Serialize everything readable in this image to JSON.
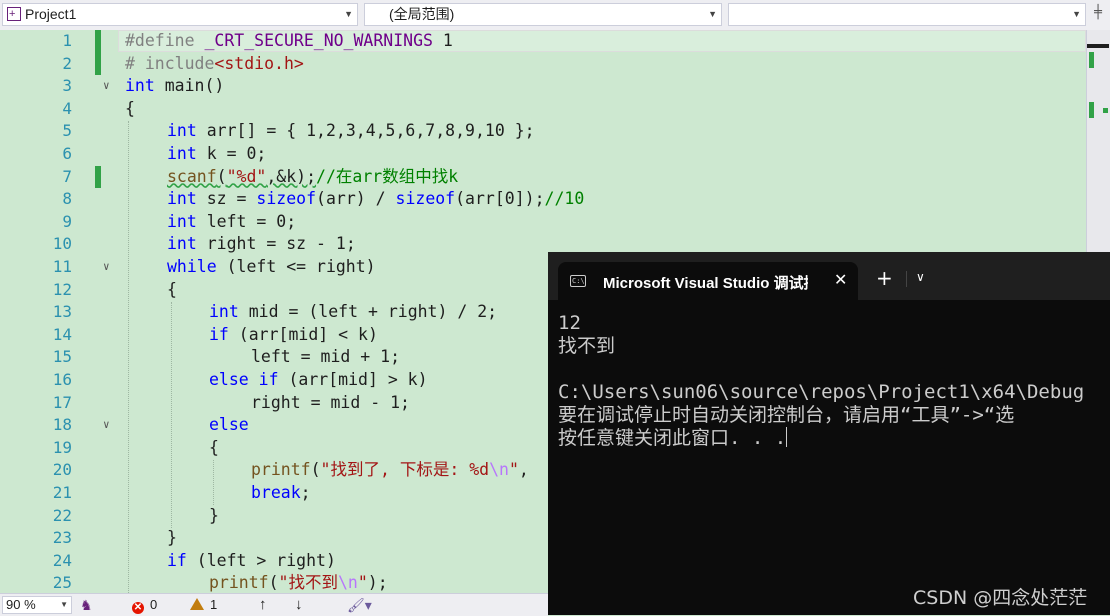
{
  "toolbar": {
    "project": "Project1",
    "scope": "(全局范围)",
    "member": ""
  },
  "editor": {
    "line_numbers": [
      "1",
      "2",
      "3",
      "4",
      "5",
      "6",
      "7",
      "8",
      "9",
      "10",
      "11",
      "12",
      "13",
      "14",
      "15",
      "16",
      "17",
      "18",
      "19",
      "20",
      "21",
      "22",
      "23",
      "24",
      "25"
    ],
    "code": {
      "l1_directive": "#define",
      "l1_macro": "_CRT_SECURE_NO_WARNINGS",
      "l1_value": " 1",
      "l2_directive": "# include",
      "l2_header": "<stdio.h>",
      "l3_kw": "int",
      "l3_rest": " main()",
      "l4": "{",
      "l5_kw": "int",
      "l5_rest": " arr[] = { 1,2,3,4,5,6,7,8,9,10 };",
      "l6_kw": "int",
      "l6_rest": " k = 0;",
      "l7_fn": "scanf",
      "l7_p1": "(",
      "l7_str": "\"%d\"",
      "l7_p2": ",&k);",
      "l7_comment": "//在arr数组中找k",
      "l8_kw": "int",
      "l8_p1": " sz = ",
      "l8_kw2": "sizeof",
      "l8_p2": "(arr) / ",
      "l8_kw3": "sizeof",
      "l8_p3": "(arr[0]);",
      "l8_comment": "//10",
      "l9_kw": "int",
      "l9_rest": " left = 0;",
      "l10_kw": "int",
      "l10_rest": " right = sz - 1;",
      "l11_kw": "while",
      "l11_rest": " (left <= right)",
      "l12": "{",
      "l13_kw": "int",
      "l13_rest": " mid = (left + right) / 2;",
      "l14_kw": "if",
      "l14_rest": " (arr[mid] < k)",
      "l15": "left = mid + 1;",
      "l16_kw": "else if",
      "l16_rest": " (arr[mid] > k)",
      "l17": "right = mid - 1;",
      "l18_kw": "else",
      "l19": "{",
      "l20_fn": "printf",
      "l20_p1": "(",
      "l20_str": "\"找到了, 下标是: %d",
      "l20_esc": "\\n",
      "l20_str2": "\"",
      "l20_p2": ",",
      "l21_kw": "break",
      "l21_p": ";",
      "l22": "}",
      "l23": "}",
      "l24_kw": "if",
      "l24_rest": " (left > right)",
      "l25_fn": "printf",
      "l25_p1": "(",
      "l25_str": "\"找不到",
      "l25_esc": "\\n",
      "l25_str2": "\"",
      "l25_p2": ");"
    }
  },
  "statusbar": {
    "zoom": "90 %",
    "errors": "0",
    "warnings": "1"
  },
  "terminal": {
    "tab_title": "Microsoft Visual Studio 调试控制台",
    "output_lines": [
      "12",
      "找不到",
      "",
      "C:\\Users\\sun06\\source\\repos\\Project1\\x64\\Debug",
      "要在调试停止时自动关闭控制台，请启用“工具”->“选",
      "按任意键关闭此窗口. . ."
    ]
  },
  "watermark": "CSDN @四念处茫茫",
  "colors": {
    "editor_bg": "#cde8d0",
    "keyword": "#0000ff",
    "string": "#a31515",
    "comment": "#008000",
    "change_marker": "#31a247",
    "terminal_bg": "#0c0c0c"
  },
  "icons": [
    "project-icon",
    "chevron-down-icon",
    "split-icon",
    "error-icon",
    "warning-icon",
    "arrow-up-icon",
    "arrow-down-icon",
    "brush-icon",
    "terminal-icon",
    "close-icon",
    "plus-icon"
  ]
}
